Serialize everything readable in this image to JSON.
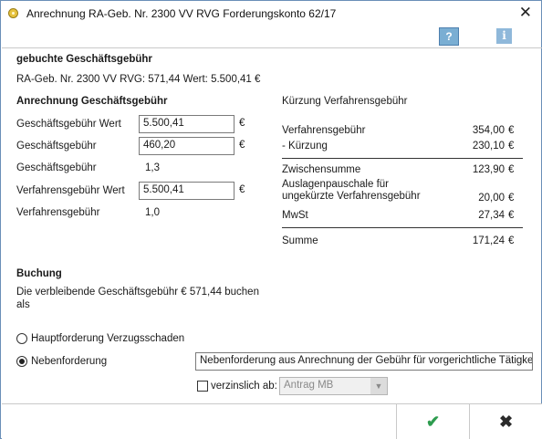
{
  "window": {
    "title": "Anrechnung RA-Geb. Nr. 2300 VV RVG Forderungskonto 62/17",
    "close": "✕"
  },
  "toolbar": {
    "help_icon": "help-icon",
    "help_glyph": "?",
    "info_icon": "info-icon",
    "info_glyph": "i"
  },
  "booked": {
    "heading": "gebuchte Geschäftsgebühr",
    "line": "RA-Geb. Nr. 2300 VV RVG: 571,44    Wert: 5.500,41 €"
  },
  "credit": {
    "heading": "Anrechnung Geschäftsgebühr",
    "rows": {
      "gg_wert_label": "Geschäftsgebühr Wert",
      "gg_wert_value": "5.500,41",
      "gg_label": "Geschäftsgebühr",
      "gg_value": "460,20",
      "gg_factor_label": "Geschäftsgebühr",
      "gg_factor_value": "1,3",
      "vg_wert_label": "Verfahrensgebühr Wert",
      "vg_wert_value": "5.500,41",
      "vg_factor_label": "Verfahrensgebühr",
      "vg_factor_value": "1,0"
    },
    "currency": "€"
  },
  "reduction": {
    "heading": "Kürzung Verfahrensgebühr",
    "items": [
      {
        "label": "Verfahrensgebühr",
        "value": "354,00",
        "unit": "€"
      },
      {
        "label": "- Kürzung",
        "value": "230,10",
        "unit": "€"
      },
      {
        "label": "Zwischensumme",
        "value": "123,90",
        "unit": "€"
      },
      {
        "label": "Auslagenpauschale für\nungekürzte Verfahrensgebühr",
        "value": "20,00",
        "unit": "€"
      },
      {
        "label": "MwSt",
        "value": "27,34",
        "unit": "€"
      },
      {
        "label": "Summe",
        "value": "171,24",
        "unit": "€"
      }
    ]
  },
  "booking": {
    "heading": "Buchung",
    "text_line1": "Die verbleibende Geschäftsgebühr € 571,44 buchen",
    "text_line2": "als",
    "option_main": "Hauptforderung Verzugsschaden",
    "option_side": "Nebenforderung",
    "selected": "Nebenforderung",
    "side_text": "Nebenforderung aus Anrechnung der Gebühr für vorgerichtliche Tätigkeit",
    "interest_label": "verzinslich ab:",
    "interest_checked": false,
    "interest_select": "Antrag MB"
  },
  "footer": {
    "ok_glyph": "✔",
    "cancel_glyph": "✖"
  }
}
